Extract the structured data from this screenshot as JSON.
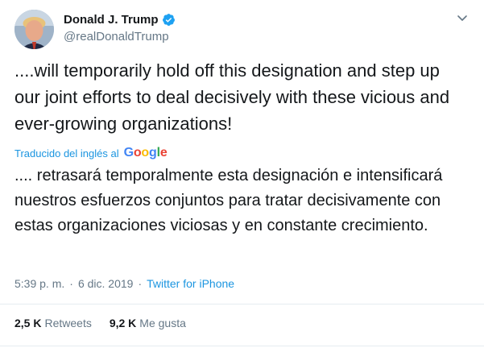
{
  "author": {
    "name": "Donald J. Trump",
    "handle": "@realDonaldTrump",
    "verified": true,
    "avatar_icon": "profile-photo"
  },
  "tweet": {
    "text": "....will temporarily hold off this designation and step up our joint efforts to deal decisively with these vicious and ever-growing organizations!",
    "translated_label": "Traducido del inglés al",
    "translation_provider": "Google",
    "translation": ".... retrasará temporalmente esta designación e intensificará nuestros esfuerzos conjuntos para tratar decisivamente con estas organizaciones viciosas y en constante crecimiento."
  },
  "meta": {
    "time": "5:39 p. m.",
    "separator": "·",
    "date": "6 dic. 2019",
    "source": "Twitter for iPhone"
  },
  "stats": {
    "retweets_count": "2,5 K",
    "retweets_label": "Retweets",
    "likes_count": "9,2 K",
    "likes_label": "Me gusta"
  },
  "colors": {
    "link": "#1b95e0",
    "secondary": "#657786",
    "verified": "#1da1f2"
  }
}
